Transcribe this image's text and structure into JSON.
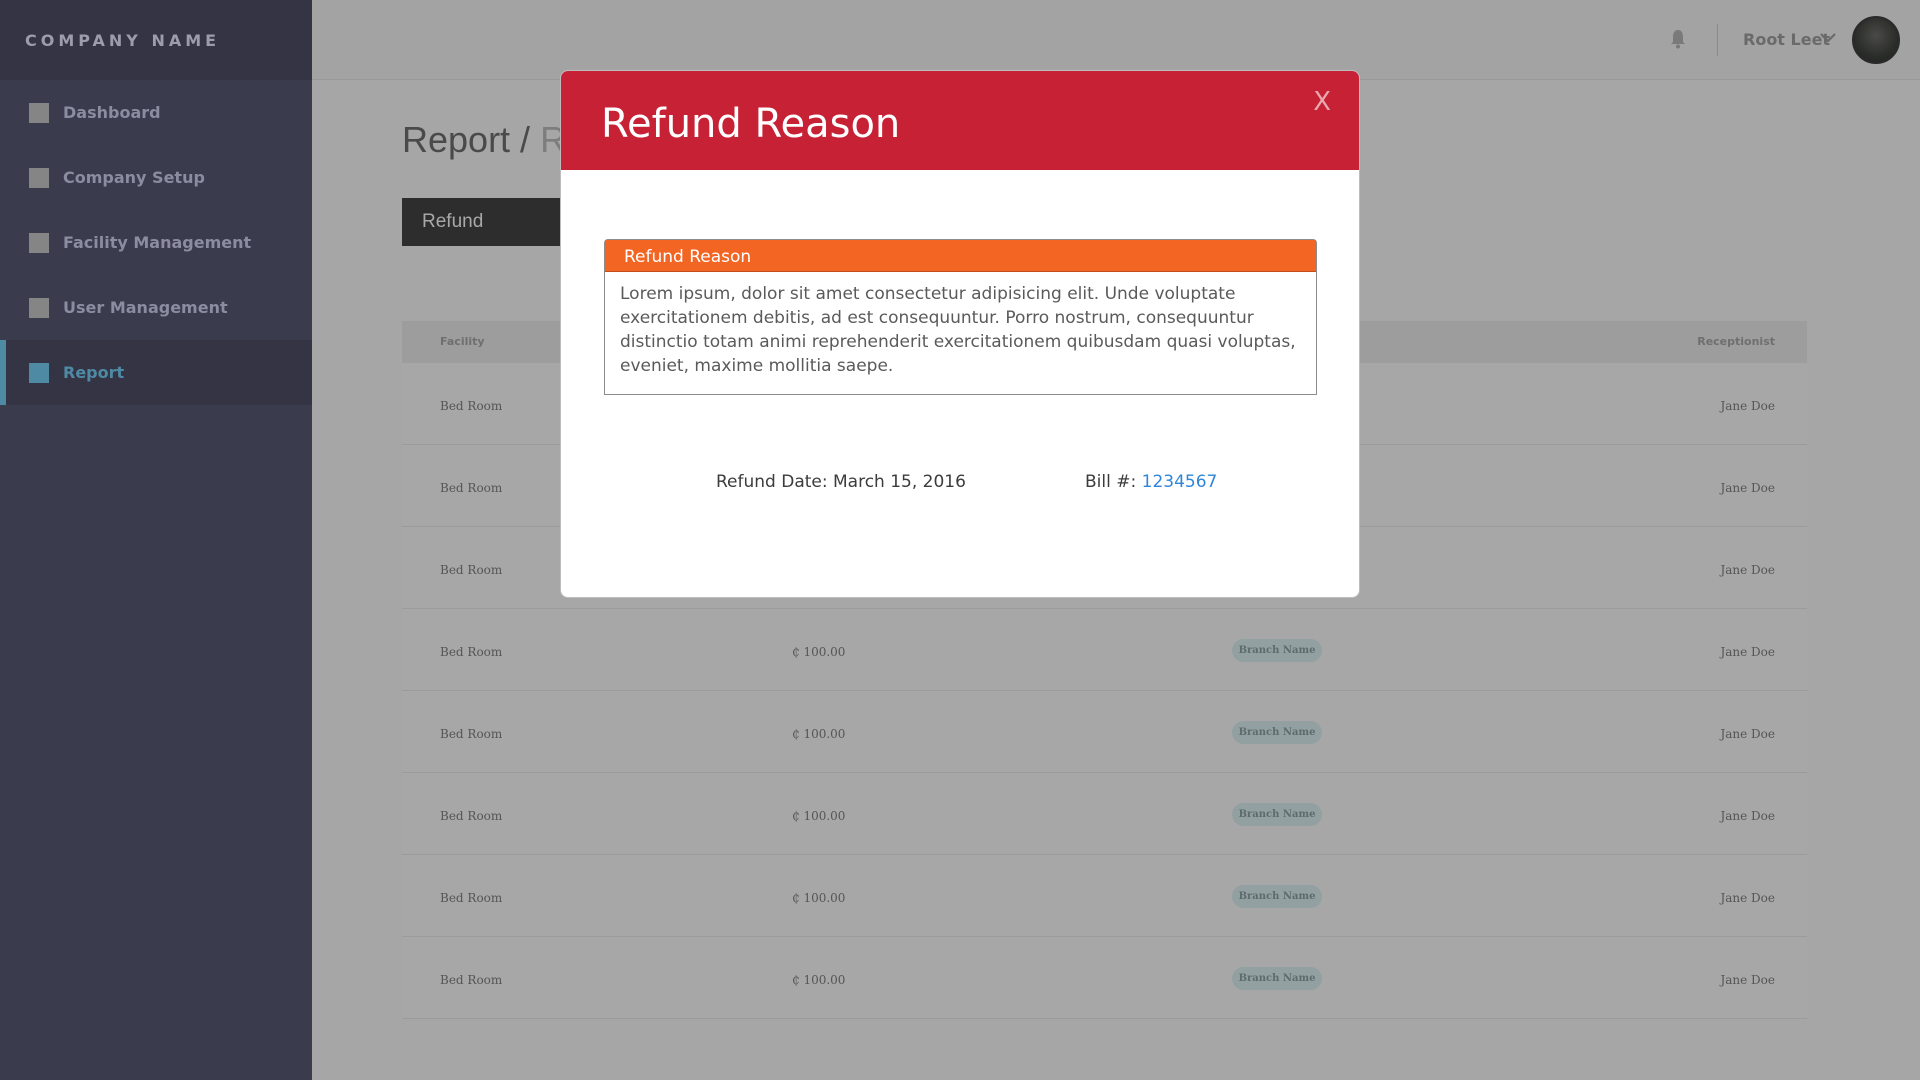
{
  "brand": {
    "name": "COMPANY NAME"
  },
  "sidebar": {
    "items": [
      {
        "label": "Dashboard",
        "active": false
      },
      {
        "label": "Company Setup",
        "active": false
      },
      {
        "label": "Facility Management",
        "active": false
      },
      {
        "label": "User Management",
        "active": false
      },
      {
        "label": "Report",
        "active": true
      }
    ]
  },
  "header": {
    "user_name": "Root Leet",
    "icons": [
      "bell-icon",
      "chevron-down-icon"
    ]
  },
  "page": {
    "title_main": "Report / ",
    "title_rest": "Re",
    "active_tab": "Refund"
  },
  "table": {
    "headers": {
      "facility": "Facility",
      "receptionist": "Receptionist"
    },
    "rows": [
      {
        "facility": "Bed Room",
        "amount": "",
        "branch": "",
        "receptionist": "Jane Doe"
      },
      {
        "facility": "Bed Room",
        "amount": "",
        "branch": "",
        "receptionist": "Jane Doe"
      },
      {
        "facility": "Bed Room",
        "amount": "",
        "branch": "",
        "receptionist": "Jane Doe"
      },
      {
        "facility": "Bed Room",
        "amount": "₵ 100.00",
        "branch": "Branch Name",
        "receptionist": "Jane Doe"
      },
      {
        "facility": "Bed Room",
        "amount": "₵ 100.00",
        "branch": "Branch Name",
        "receptionist": "Jane Doe"
      },
      {
        "facility": "Bed Room",
        "amount": "₵ 100.00",
        "branch": "Branch Name",
        "receptionist": "Jane Doe"
      },
      {
        "facility": "Bed Room",
        "amount": "₵ 100.00",
        "branch": "Branch Name",
        "receptionist": "Jane Doe"
      },
      {
        "facility": "Bed Room",
        "amount": "₵ 100.00",
        "branch": "Branch Name",
        "receptionist": "Jane Doe"
      }
    ]
  },
  "modal": {
    "title": "Refund Reason",
    "close_label": "X",
    "reason_heading": "Refund Reason",
    "reason_text": "Lorem ipsum, dolor sit amet consectetur adipisicing elit. Unde voluptate exercitationem debitis, ad est consequuntur. Porro nostrum, consequuntur distinctio totam animi reprehenderit exercitationem quibusdam quasi voluptas, eveniet, maxime mollitia saepe.",
    "refund_date_label": "Refund Date: March 15, 2016",
    "bill_label": "Bill #: ",
    "bill_number": "1234567"
  },
  "colors": {
    "sidebar_bg": "#3b3b4e",
    "active_accent": "#4f8aa5",
    "modal_header": "#c72135",
    "reason_header": "#f26522",
    "bill_link": "#2f86d8"
  }
}
